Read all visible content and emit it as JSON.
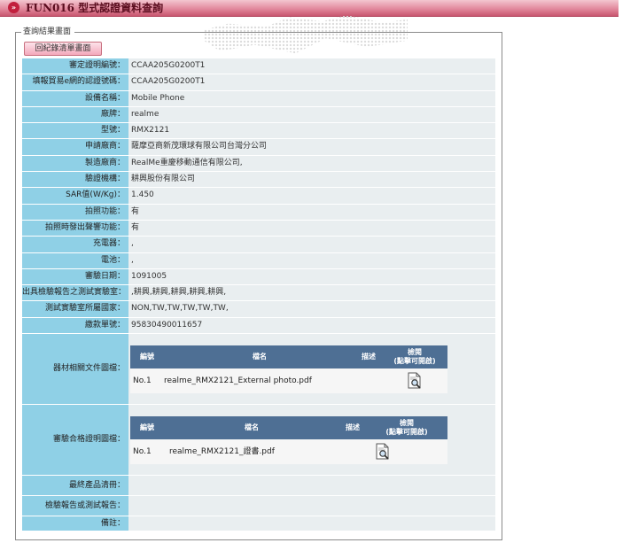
{
  "header": {
    "title": "FUN016 型式認證資料查詢"
  },
  "section": {
    "legend": "查詢結果畫面",
    "back_button": "回紀錄清單畫面"
  },
  "fields": [
    {
      "label": "審定證明編號：",
      "value": "CCAA205G0200T1"
    },
    {
      "label": "填報貿易e網的認證號碼：",
      "value": "CCAA205G0200T1"
    },
    {
      "label": "設備名稱：",
      "value": "Mobile Phone"
    },
    {
      "label": "廠牌：",
      "value": "realme"
    },
    {
      "label": "型號：",
      "value": "RMX2121"
    },
    {
      "label": "申請廠商：",
      "value": "薩摩亞商新茂環球有限公司台灣分公司"
    },
    {
      "label": "製造廠商：",
      "value": "RealMe重慶移動通信有限公司,"
    },
    {
      "label": "驗證機構：",
      "value": "耕興股份有限公司"
    },
    {
      "label": "SAR值(W/Kg)：",
      "value": "1.450"
    },
    {
      "label": "拍照功能：",
      "value": "有"
    },
    {
      "label": "拍照時發出聲響功能：",
      "value": "有"
    },
    {
      "label": "充電器：",
      "value": ","
    },
    {
      "label": "電池：",
      "value": ","
    },
    {
      "label": "審驗日期：",
      "value": "1091005"
    },
    {
      "label": "出具檢驗報告之測試實驗室：",
      "value": ",耕興,耕興,耕興,耕興,耕興,"
    },
    {
      "label": "測試實驗室所屬國家：",
      "value": "NON,TW,TW,TW,TW,TW,"
    },
    {
      "label": "繳款單號：",
      "value": "95830490011657"
    }
  ],
  "equipment_docs": {
    "label": "器材相關文件圖檔：",
    "headers": {
      "no": "編號",
      "file": "檔名",
      "desc": "描述",
      "view1": "檢閱",
      "view2": "(點擊可開啟)"
    },
    "rows": [
      {
        "no": "No.1",
        "file": "realme_RMX2121_External photo.pdf",
        "desc": ""
      }
    ]
  },
  "cert_docs": {
    "label": "審驗合格證明圖檔：",
    "headers": {
      "no": "編號",
      "file": "檔名",
      "desc": "描述",
      "view1": "檢閱",
      "view2": "(點擊可開啟)"
    },
    "rows": [
      {
        "no": "No.1",
        "file": "realme_RMX2121_證書.pdf",
        "desc": ""
      }
    ]
  },
  "tail_fields": [
    {
      "label": "最終產品清冊：",
      "value": ""
    },
    {
      "label": "檢驗報告或測試報告：",
      "value": ""
    },
    {
      "label": "備註：",
      "value": ""
    }
  ],
  "icons": [
    "title-arrow-icon",
    "document-search-icon"
  ],
  "colors": {
    "label_bg": "#8fd0e6",
    "value_bg": "#e9eef0",
    "table_header": "#4e6f94",
    "title_bar": "#e2899d"
  }
}
